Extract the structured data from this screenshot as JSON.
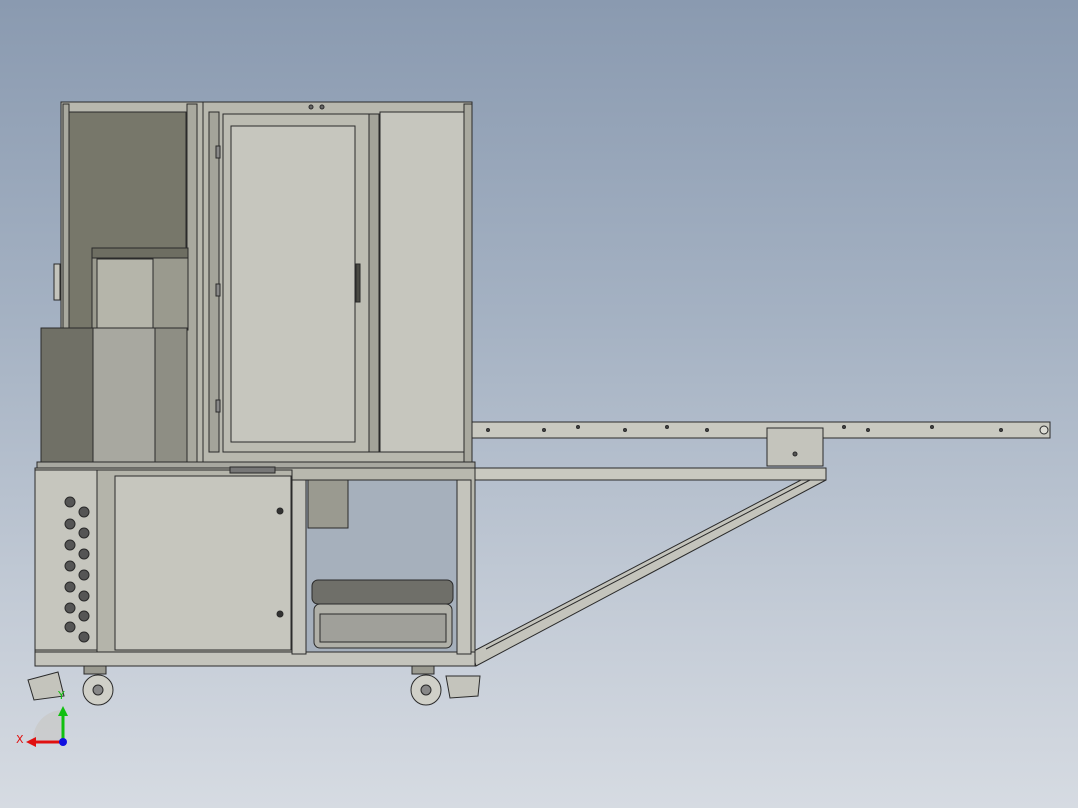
{
  "viewport": {
    "background_top": "#8a9ab0",
    "background_bottom": "#d6dbe2"
  },
  "model": {
    "panel_color": "#c4c4bc",
    "dark_panel_color": "#7a7a6c",
    "frame_color": "#b8b8ae",
    "edge_color": "#2a2a2a"
  },
  "triad": {
    "x_label": "X",
    "y_label": "Y",
    "x_color": "#e01010",
    "y_color": "#10c010",
    "z_color": "#1010e0"
  }
}
